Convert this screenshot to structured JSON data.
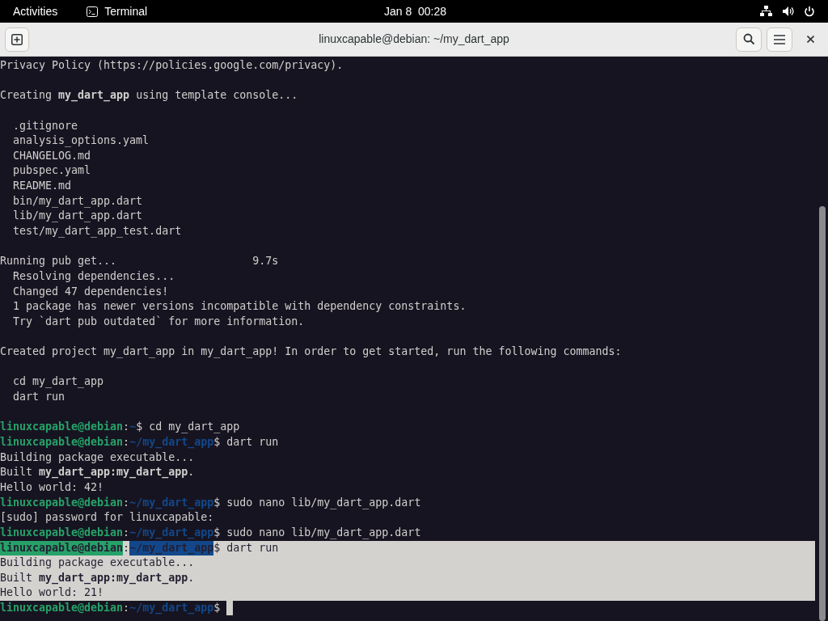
{
  "top_bar": {
    "activities": "Activities",
    "app_name": "Terminal",
    "clock": "Jan 8  00:28"
  },
  "window": {
    "title": "linuxcapable@debian: ~/my_dart_app"
  },
  "terminal": {
    "lines": [
      {
        "kind": "text",
        "text": "Privacy Policy (https://policies.google.com/privacy).",
        "selected": false
      },
      {
        "kind": "blank",
        "selected": false
      },
      {
        "kind": "text",
        "text": "Creating **my_dart_app** using template console...",
        "selected": false
      },
      {
        "kind": "blank",
        "selected": false
      },
      {
        "kind": "text",
        "text": "  .gitignore",
        "selected": false
      },
      {
        "kind": "text",
        "text": "  analysis_options.yaml",
        "selected": false
      },
      {
        "kind": "text",
        "text": "  CHANGELOG.md",
        "selected": false
      },
      {
        "kind": "text",
        "text": "  pubspec.yaml",
        "selected": false
      },
      {
        "kind": "text",
        "text": "  README.md",
        "selected": false
      },
      {
        "kind": "text",
        "text": "  bin/my_dart_app.dart",
        "selected": false
      },
      {
        "kind": "text",
        "text": "  lib/my_dart_app.dart",
        "selected": false
      },
      {
        "kind": "text",
        "text": "  test/my_dart_app_test.dart",
        "selected": false
      },
      {
        "kind": "blank",
        "selected": false
      },
      {
        "kind": "text",
        "text": "Running pub get...                     9.7s",
        "selected": false
      },
      {
        "kind": "text",
        "text": "  Resolving dependencies...",
        "selected": false
      },
      {
        "kind": "text",
        "text": "  Changed 47 dependencies!",
        "selected": false
      },
      {
        "kind": "text",
        "text": "  1 package has newer versions incompatible with dependency constraints.",
        "selected": false
      },
      {
        "kind": "text",
        "text": "  Try `dart pub outdated` for more information.",
        "selected": false
      },
      {
        "kind": "blank",
        "selected": false
      },
      {
        "kind": "text",
        "text": "Created project my_dart_app in my_dart_app! In order to get started, run the following commands:",
        "selected": false
      },
      {
        "kind": "blank",
        "selected": false
      },
      {
        "kind": "text",
        "text": "  cd my_dart_app",
        "selected": false
      },
      {
        "kind": "text",
        "text": "  dart run",
        "selected": false
      },
      {
        "kind": "blank",
        "selected": false
      },
      {
        "kind": "prompt",
        "user": "linuxcapable@debian",
        "separator": ":",
        "path": "~",
        "symbol": "$",
        "command": "cd my_dart_app",
        "selected": false
      },
      {
        "kind": "prompt",
        "user": "linuxcapable@debian",
        "separator": ":",
        "path": "~/my_dart_app",
        "symbol": "$",
        "command": "dart run",
        "selected": false
      },
      {
        "kind": "text",
        "text": "Building package executable...",
        "selected": false
      },
      {
        "kind": "text",
        "text": "Built **my_dart_app:my_dart_app**.",
        "selected": false
      },
      {
        "kind": "text",
        "text": "Hello world: 42!",
        "selected": false
      },
      {
        "kind": "prompt",
        "user": "linuxcapable@debian",
        "separator": ":",
        "path": "~/my_dart_app",
        "symbol": "$",
        "command": "sudo nano lib/my_dart_app.dart",
        "selected": false
      },
      {
        "kind": "text",
        "text": "[sudo] password for linuxcapable:",
        "selected": false
      },
      {
        "kind": "prompt",
        "user": "linuxcapable@debian",
        "separator": ":",
        "path": "~/my_dart_app",
        "symbol": "$",
        "command": "sudo nano lib/my_dart_app.dart",
        "selected": false
      },
      {
        "kind": "prompt",
        "user": "linuxcapable@debian",
        "separator": ":",
        "path": "~/my_dart_app",
        "symbol": "$",
        "command": "dart run",
        "selected": true
      },
      {
        "kind": "text",
        "text": "Building package executable...",
        "selected": true
      },
      {
        "kind": "text",
        "text": "Built **my_dart_app:my_dart_app**.",
        "selected": true
      },
      {
        "kind": "text",
        "text": "Hello world: 21!",
        "selected": true
      },
      {
        "kind": "prompt",
        "user": "linuxcapable@debian",
        "separator": ":",
        "path": "~/my_dart_app",
        "symbol": "$",
        "selected": false,
        "cursor": true
      }
    ]
  }
}
